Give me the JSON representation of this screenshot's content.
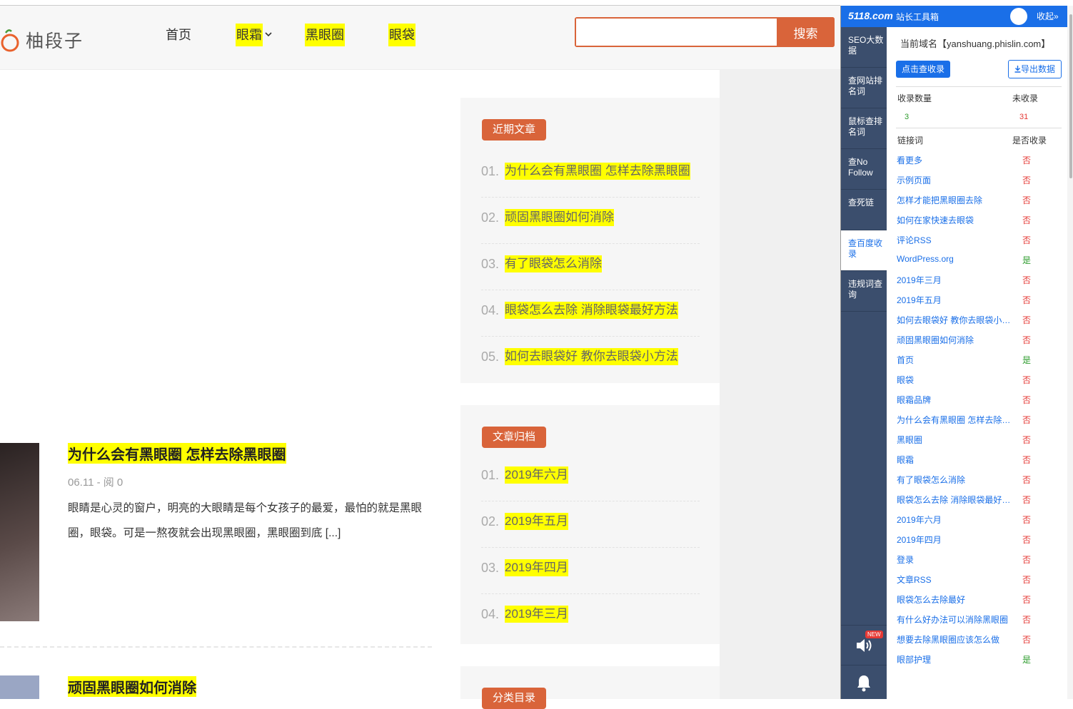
{
  "site": {
    "logo_text": "柚段子",
    "nav": [
      {
        "label": "首页",
        "highlighted": false
      },
      {
        "label": "眼霜",
        "highlighted": true
      },
      {
        "label": "黑眼圈",
        "highlighted": true
      },
      {
        "label": "眼袋",
        "highlighted": true
      }
    ],
    "search": {
      "value": "",
      "placeholder": "",
      "button_label": "搜索"
    }
  },
  "recent": {
    "title": "近期文章",
    "items": [
      {
        "num": "01.",
        "text": "为什么会有黑眼圈 怎样去除黑眼圈"
      },
      {
        "num": "02.",
        "text": "顽固黑眼圈如何消除"
      },
      {
        "num": "03.",
        "text": "有了眼袋怎么消除"
      },
      {
        "num": "04.",
        "text": "眼袋怎么去除 消除眼袋最好方法"
      },
      {
        "num": "05.",
        "text": "如何去眼袋好 教你去眼袋小方法"
      }
    ]
  },
  "archive": {
    "title": "文章归档",
    "items": [
      {
        "num": "01.",
        "text": "2019年六月"
      },
      {
        "num": "02.",
        "text": "2019年五月"
      },
      {
        "num": "03.",
        "text": "2019年四月"
      },
      {
        "num": "04.",
        "text": "2019年三月"
      }
    ]
  },
  "categories": {
    "title": "分类目录"
  },
  "posts": [
    {
      "title": "为什么会有黑眼圈 怎样去除黑眼圈",
      "meta": "06.11 - 阅 0",
      "excerpt": "眼睛是心灵的窗户，明亮的大眼睛是每个女孩子的最爱，最怕的就是黑眼圈，眼袋。可是一熬夜就会出现黑眼圈，黑眼圈到底 [...]"
    },
    {
      "title": "顽固黑眼圈如何消除"
    }
  ],
  "panel": {
    "brand": "5118.com",
    "tool_name": "站长工具箱",
    "collapse_label": "收起»",
    "tabs": [
      {
        "label": "SEO大数据",
        "active": false
      },
      {
        "label": "查网站排名词",
        "active": false
      },
      {
        "label": "鼠标查排名词",
        "active": false
      },
      {
        "label": "查No Follow",
        "active": false
      },
      {
        "label": "查死链",
        "active": false
      },
      {
        "label": "查百度收录",
        "active": true
      },
      {
        "label": "违规词查询",
        "active": false
      }
    ],
    "new_badge": "NEW",
    "domain_label": "当前域名【yanshuang.phislin.com】",
    "check_button": "点击查收录",
    "export_button": "导出数据",
    "stats": {
      "indexed_label": "收录数量",
      "indexed_value": "3",
      "not_indexed_label": "未收录",
      "not_indexed_value": "31"
    },
    "list_header": {
      "link_label": "链接词",
      "status_label": "是否收录"
    },
    "links": [
      {
        "text": "看更多",
        "status": "否"
      },
      {
        "text": "示例页面",
        "status": "否"
      },
      {
        "text": "怎样才能把黑眼圈去除",
        "status": "否"
      },
      {
        "text": "如何在家快速去眼袋",
        "status": "否"
      },
      {
        "text": "评论RSS",
        "status": "否"
      },
      {
        "text": "WordPress.org",
        "status": "是"
      },
      {
        "text": "2019年三月",
        "status": "否"
      },
      {
        "text": "2019年五月",
        "status": "否"
      },
      {
        "text": "如何去眼袋好 教你去眼袋小方法",
        "status": "否"
      },
      {
        "text": "顽固黑眼圈如何消除",
        "status": "否"
      },
      {
        "text": "首页",
        "status": "是"
      },
      {
        "text": "眼袋",
        "status": "否"
      },
      {
        "text": "眼霜品牌",
        "status": "否"
      },
      {
        "text": "为什么会有黑眼圈 怎样去除黑眼圈",
        "status": "否"
      },
      {
        "text": "黑眼圈",
        "status": "否"
      },
      {
        "text": "眼霜",
        "status": "否"
      },
      {
        "text": "有了眼袋怎么消除",
        "status": "否"
      },
      {
        "text": "眼袋怎么去除 消除眼袋最好方法",
        "status": "否"
      },
      {
        "text": "2019年六月",
        "status": "否"
      },
      {
        "text": "2019年四月",
        "status": "否"
      },
      {
        "text": "登录",
        "status": "否"
      },
      {
        "text": "文章RSS",
        "status": "否"
      },
      {
        "text": "眼袋怎么去除最好",
        "status": "否"
      },
      {
        "text": "有什么好办法可以消除黑眼圈",
        "status": "否"
      },
      {
        "text": "想要去除黑眼圈应该怎么做",
        "status": "否"
      },
      {
        "text": "眼部护理",
        "status": "是"
      }
    ]
  },
  "colors": {
    "accent": "#d9643a",
    "panel_blue": "#1a6fe8",
    "panel_nav": "#3b4e6d",
    "highlight": "#ffff00"
  }
}
